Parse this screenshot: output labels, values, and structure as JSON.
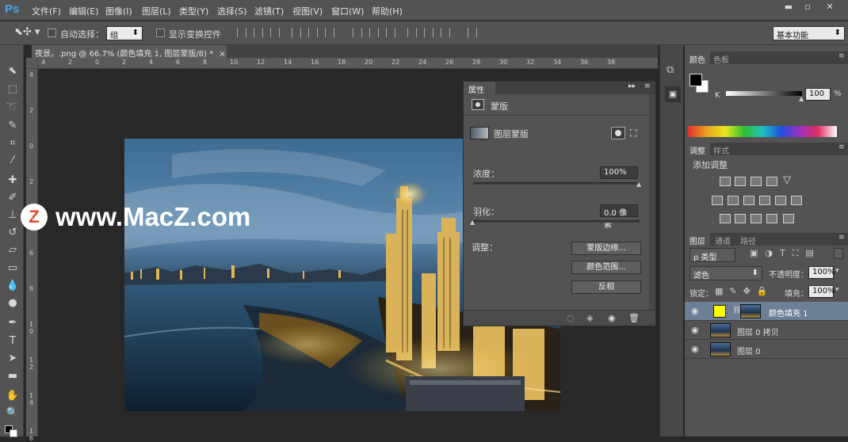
{
  "app": {
    "logo": "Ps"
  },
  "menu": [
    "文件(F)",
    "编辑(E)",
    "图像(I)",
    "图层(L)",
    "类型(Y)",
    "选择(S)",
    "滤镜(T)",
    "视图(V)",
    "窗口(W)",
    "帮助(H)"
  ],
  "window_controls": {
    "minimize": "▬",
    "maximize": "▫",
    "close": "✕"
  },
  "options": {
    "auto_select_label": "自动选择：",
    "auto_select_value": "组",
    "show_transform_label": "显示变换控件",
    "workspace": "基本功能"
  },
  "document": {
    "tab_title": "夜景。.png @ 66.7% (颜色填充 1, 图层蒙版/8) *",
    "close": "×"
  },
  "ruler": {
    "h_labels": [
      "4",
      "2",
      "0",
      "2",
      "4",
      "6",
      "8",
      "10",
      "12",
      "14",
      "16",
      "18",
      "20",
      "22",
      "24",
      "26",
      "28",
      "30",
      "32",
      "34",
      "36",
      "38"
    ],
    "v_labels": [
      "4",
      "2",
      "0",
      "2",
      "4",
      "6",
      "8",
      "1 0",
      "1 2",
      "1 4",
      "1 6"
    ]
  },
  "watermark": {
    "logo_letter": "Z",
    "text": "www.MacZ.com"
  },
  "properties": {
    "title": "属性",
    "section": "蒙版",
    "mask_type": "图层蒙版",
    "density_label": "浓度：",
    "density_value": "100%",
    "feather_label": "羽化：",
    "feather_value": "0.0 像素",
    "adjust_label": "调整：",
    "btn_mask_edge": "蒙版边缘...",
    "btn_color_range": "颜色范围...",
    "btn_invert": "反相",
    "density_level": 1.0,
    "feather_level": 0.0
  },
  "color_panel": {
    "tabs": [
      "颜色",
      "色板"
    ],
    "channel": "K",
    "value": "100",
    "unit": "%",
    "k_level": 1.0
  },
  "adjustments_panel": {
    "tabs": [
      "调整",
      "样式"
    ],
    "heading": "添加调整"
  },
  "layers_panel": {
    "tabs": [
      "图层",
      "通道",
      "路径"
    ],
    "filter_kind": "ρ 类型",
    "blend_mode": "滤色",
    "opacity_label": "不透明度：",
    "opacity_value": "100%",
    "lock_label": "锁定：",
    "fill_label": "填充：",
    "fill_value": "100%",
    "layers": [
      {
        "name": "颜色填充 1",
        "swatch": "#ffff00"
      },
      {
        "name": "图层 0 拷贝"
      },
      {
        "name": "图层 0"
      }
    ]
  }
}
